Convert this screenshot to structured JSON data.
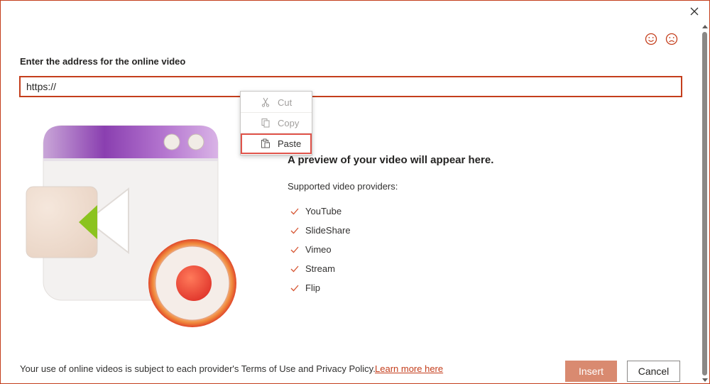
{
  "dialog": {
    "input_label": "Enter the address for the online video",
    "url_value": "https://",
    "preview_title": "A preview of your video will appear here.",
    "providers_label": "Supported video providers:",
    "providers": [
      "YouTube",
      "SlideShare",
      "Vimeo",
      "Stream",
      "Flip"
    ],
    "terms_text": "Your use of online videos is subject to each provider's Terms of Use and Privacy Policy.",
    "learn_more": "Learn more here",
    "insert_label": "Insert",
    "cancel_label": "Cancel"
  },
  "context_menu": {
    "items": [
      {
        "label": "Cut",
        "icon": "scissors-icon",
        "enabled": false
      },
      {
        "label": "Copy",
        "icon": "copy-icon",
        "enabled": false
      },
      {
        "label": "Paste",
        "icon": "paste-icon",
        "enabled": true,
        "highlighted": true
      }
    ]
  },
  "colors": {
    "accent": "#c43e1c",
    "insert_button": "#d98a70",
    "check": "#d65532"
  },
  "icons": [
    "close-icon",
    "smile-icon",
    "frown-icon",
    "checkmark-icon"
  ]
}
